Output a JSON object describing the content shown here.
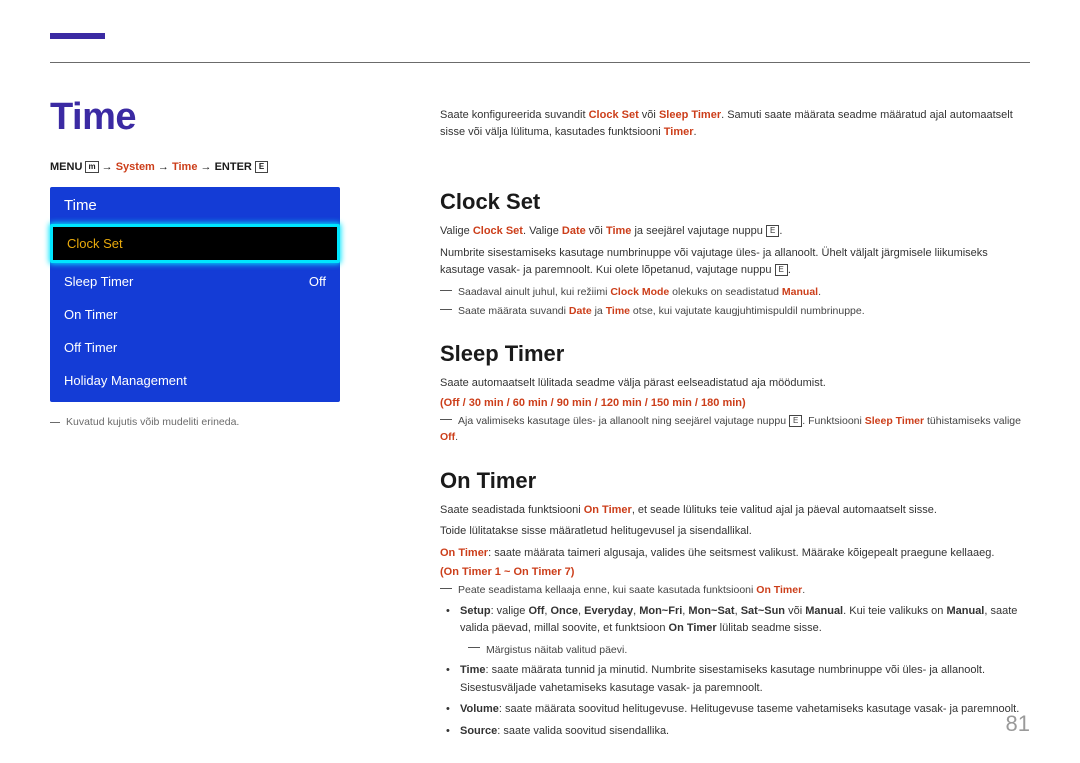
{
  "page": {
    "title": "Time",
    "number": "81"
  },
  "menuPath": {
    "menu": "MENU",
    "menuIcon": "m",
    "arrow1": " → ",
    "system": "System",
    "arrow2": " → ",
    "time": "Time",
    "arrow3": " → ",
    "enter": "ENTER",
    "enterIcon": "E"
  },
  "sim": {
    "title": "Time",
    "items": [
      {
        "label": "Clock Set",
        "value": "",
        "selected": true
      },
      {
        "label": "Sleep Timer",
        "value": "Off",
        "selected": false
      },
      {
        "label": "On Timer",
        "value": "",
        "selected": false
      },
      {
        "label": "Off Timer",
        "value": "",
        "selected": false
      },
      {
        "label": "Holiday Management",
        "value": "",
        "selected": false
      }
    ],
    "caption": "Kuvatud kujutis võib mudeliti erineda."
  },
  "intro": {
    "p1a": "Saate konfigureerida suvandit ",
    "p1b": "Clock Set",
    "p1c": " või ",
    "p1d": "Sleep Timer",
    "p1e": ". Samuti saate määrata seadme määratud ajal automaatselt sisse või välja lülituma, kasutades funktsiooni ",
    "p1f": "Timer",
    "p1g": "."
  },
  "clockSet": {
    "h": "Clock Set",
    "p1a": "Valige ",
    "p1b": "Clock Set",
    "p1c": ". Valige ",
    "p1d": "Date",
    "p1e": " või ",
    "p1f": "Time",
    "p1g": " ja seejärel vajutage nuppu ",
    "p1h": ".",
    "p2": "Numbrite sisestamiseks kasutage numbrinuppe või vajutage üles- ja allanoolt. Ühelt väljalt järgmisele liikumiseks kasutage vasak- ja paremnoolt. Kui olete lõpetanud, vajutage nuppu ",
    "p2b": ".",
    "n1a": "Saadaval ainult juhul, kui režiimi ",
    "n1b": "Clock Mode",
    "n1c": " olekuks on seadistatud ",
    "n1d": "Manual",
    "n1e": ".",
    "n2a": "Saate määrata suvandi ",
    "n2b": "Date",
    "n2c": " ja ",
    "n2d": "Time",
    "n2e": " otse, kui vajutate kaugjuhtimispuldil numbrinuppe."
  },
  "sleepTimer": {
    "h": "Sleep Timer",
    "p1": "Saate automaatselt lülitada seadme välja pärast eelseadistatud aja möödumist.",
    "opts": "(Off / 30 min / 60 min / 90 min / 120 min / 150 min / 180 min)",
    "n1a": "Aja valimiseks kasutage üles- ja allanoolt ning seejärel vajutage nuppu ",
    "n1b": ". Funktsiooni ",
    "n1c": "Sleep Timer",
    "n1d": " tühistamiseks valige ",
    "n1e": "Off",
    "n1f": "."
  },
  "onTimer": {
    "h": "On Timer",
    "p1a": "Saate seadistada funktsiooni ",
    "p1b": "On Timer",
    "p1c": ", et seade lülituks teie valitud ajal ja päeval automaatselt sisse.",
    "p2": "Toide lülitatakse sisse määratletud helitugevusel ja sisendallikal.",
    "p3a": "On Timer",
    "p3b": ": saate määrata taimeri algusaja, valides ühe seitsmest valikust. Määrake kõigepealt praegune kellaaeg.",
    "opts": "(On Timer 1 ~ On Timer 7)",
    "n1a": "Peate seadistama kellaaja enne, kui saate kasutada funktsiooni ",
    "n1b": "On Timer",
    "n1c": ".",
    "setup_a": "Setup",
    "setup_b": ": valige ",
    "setup_c": "Off",
    "setup_d": ", ",
    "setup_e": "Once",
    "setup_f": ", ",
    "setup_g": "Everyday",
    "setup_h": ", ",
    "setup_i": "Mon~Fri",
    "setup_j": ", ",
    "setup_k": "Mon~Sat",
    "setup_l": ", ",
    "setup_m": "Sat~Sun",
    "setup_n": " või ",
    "setup_o": "Manual",
    "setup_p": ". Kui teie valikuks on ",
    "setup_q": "Manual",
    "setup_r": ", saate valida päevad, millal soovite, et funktsioon ",
    "setup_s": "On Timer",
    "setup_t": " lülitab seadme sisse.",
    "setup_sub": "Märgistus näitab valitud päevi.",
    "time_a": "Time",
    "time_b": ": saate määrata tunnid ja minutid. Numbrite sisestamiseks kasutage numbrinuppe või üles- ja allanoolt. Sisestusväljade vahetamiseks kasutage vasak- ja paremnoolt.",
    "vol_a": "Volume",
    "vol_b": ": saate määrata soovitud helitugevuse. Helitugevuse taseme vahetamiseks kasutage vasak- ja paremnoolt.",
    "src_a": "Source",
    "src_b": ": saate valida soovitud sisendallika."
  }
}
